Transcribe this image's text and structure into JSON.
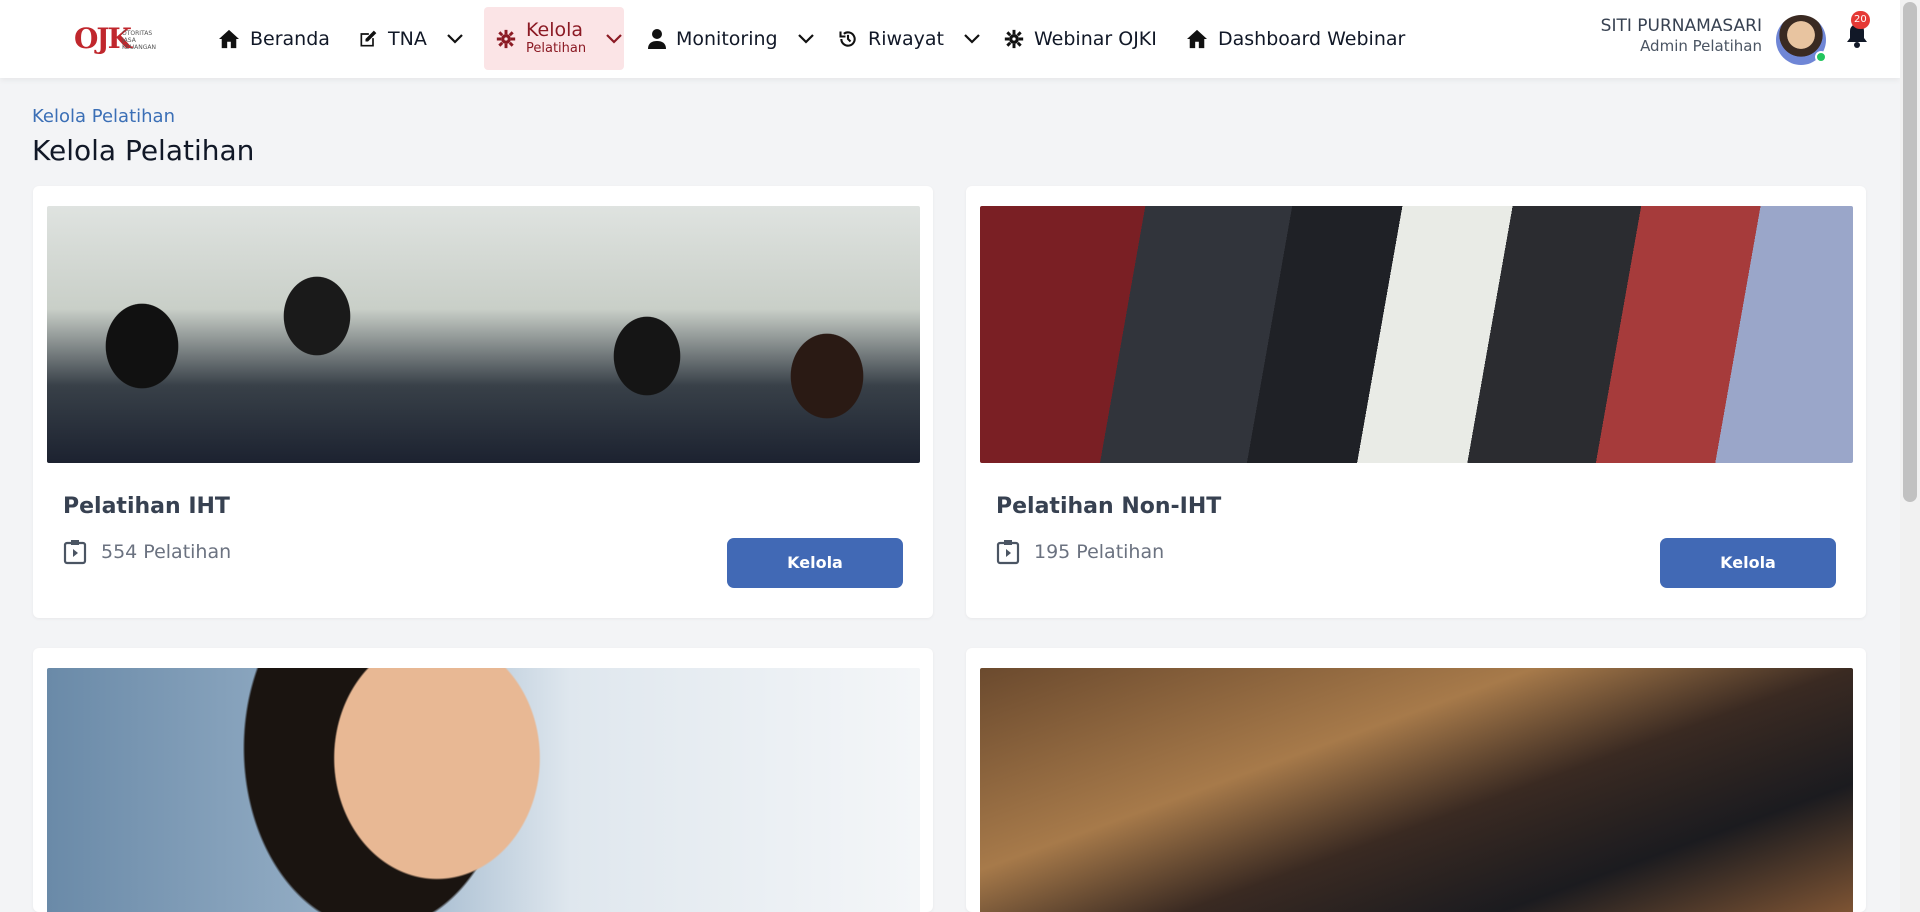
{
  "logo": {
    "mark": "OJK",
    "text_lines": [
      "OTORITAS",
      "JASA",
      "KEUANGAN"
    ]
  },
  "nav": {
    "beranda": "Beranda",
    "tna": "TNA",
    "kelola": "Kelola",
    "kelola_sub": "Pelatihan",
    "monitoring": "Monitoring",
    "riwayat": "Riwayat",
    "webinar": "Webinar OJKI",
    "dashboard": "Dashboard Webinar"
  },
  "user": {
    "name": "SITI PURNAMASARI",
    "role": "Admin Pelatihan",
    "notifications": "20"
  },
  "header": {
    "breadcrumb": "Kelola Pelatihan",
    "title": "Kelola Pelatihan"
  },
  "cards": [
    {
      "title": "Pelatihan IHT",
      "count": "554 Pelatihan",
      "button": "Kelola"
    },
    {
      "title": "Pelatihan Non-IHT",
      "count": "195 Pelatihan",
      "button": "Kelola"
    },
    {
      "title": "",
      "count": "",
      "button": ""
    },
    {
      "title": "",
      "count": "",
      "button": ""
    }
  ],
  "colors": {
    "accent": "#4169b5",
    "active_nav_bg": "#fbe4e6",
    "active_nav_text": "#8b1a24",
    "breadcrumb": "#3b6fb6"
  }
}
